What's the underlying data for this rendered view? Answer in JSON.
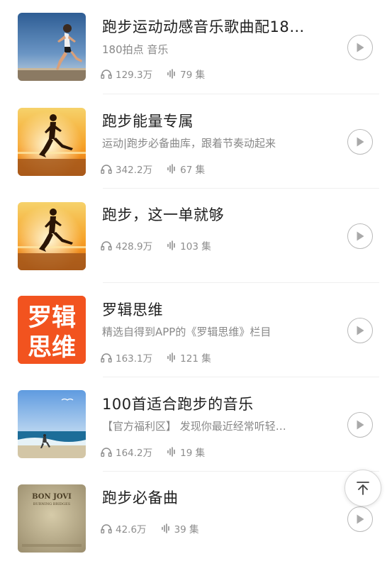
{
  "playlists": [
    {
      "title": "跑步运动动感音乐歌曲配18…",
      "subtitle": "180拍点 音乐",
      "plays": "129.3万",
      "episodes": "79 集"
    },
    {
      "title": "跑步能量专属",
      "subtitle": "运动|跑步必备曲库，跟着节奏动起来",
      "plays": "342.2万",
      "episodes": "67 集"
    },
    {
      "title": "跑步，这一单就够",
      "subtitle": "",
      "plays": "428.9万",
      "episodes": "103 集"
    },
    {
      "title": "罗辑思维",
      "subtitle": "精选自得到APP的《罗辑思维》栏目",
      "plays": "163.1万",
      "episodes": "121 集",
      "cover_text_line1": "罗辑",
      "cover_text_line2": "思维"
    },
    {
      "title": "100首适合跑步的音乐",
      "subtitle": "【官方福利区】 发现你最近经常听轻…",
      "plays": "164.2万",
      "episodes": "19 集"
    },
    {
      "title": "跑步必备曲",
      "subtitle": "",
      "plays": "42.6万",
      "episodes": "39 集",
      "cover_text_line1": "BON JOVI",
      "cover_text_line2": "BURNING BRIDGES"
    }
  ],
  "icons": {
    "plays": "headphones-icon",
    "episodes": "audio-wave-icon",
    "play": "play-icon",
    "back_to_top": "arrow-up-to-top-icon"
  },
  "colors": {
    "title": "#1f1f1f",
    "meta": "#8d8d8d",
    "logic_cover": "#f2531f"
  }
}
